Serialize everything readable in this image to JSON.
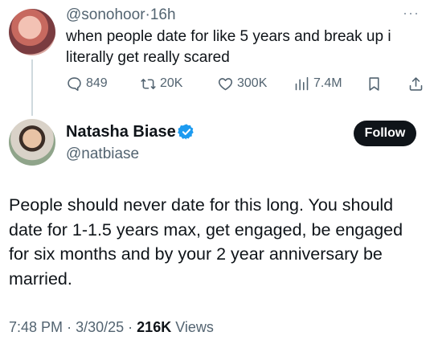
{
  "reply": {
    "handle": "@sonohoor",
    "separator": "·",
    "time": "16h",
    "more_label": "···",
    "text": "when people date for like 5 years and break up i literally get really scared",
    "actions": {
      "replies": "849",
      "reposts": "20K",
      "likes": "300K",
      "views": "7.4M"
    }
  },
  "main": {
    "name": "Natasha Biase",
    "handle": "@natbiase",
    "follow_label": "Follow",
    "text": "People should never date for this long. You should date for 1-1.5 years max, get engaged, be engaged for six months and by your 2 year anniversary be married.",
    "time": "7:48 PM",
    "date": "3/30/25",
    "separator": "·",
    "views_count": "216K",
    "views_label": "Views"
  },
  "colors": {
    "verified": "#1d9bf0",
    "muted": "#536471",
    "text": "#0f1419"
  },
  "icons": [
    "reply-icon",
    "repost-icon",
    "like-icon",
    "views-icon",
    "bookmark-icon",
    "share-icon",
    "verified-badge-icon"
  ]
}
